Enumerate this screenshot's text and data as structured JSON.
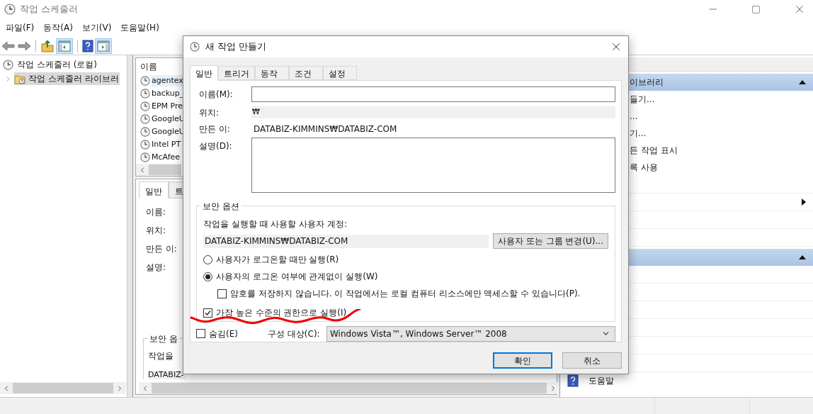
{
  "window": {
    "title": "작업 스케줄러"
  },
  "menu": [
    "파일(F)",
    "동작(A)",
    "보기(V)",
    "도움말(H)"
  ],
  "tree": [
    {
      "label": "작업 스케줄러 (로컬)",
      "selected": false,
      "children": [
        {
          "label": "작업 스케줄러 라이브러",
          "selected": true,
          "expanded": false
        }
      ]
    }
  ],
  "task_list": {
    "column": "이름",
    "rows": [
      {
        "name": "agentex",
        "selected": true
      },
      {
        "name": "backup_",
        "selected": false
      },
      {
        "name": "EPM Pre",
        "selected": false
      },
      {
        "name": "GoogleU",
        "selected": false
      },
      {
        "name": "GoogleU",
        "selected": false
      },
      {
        "name": "Intel PT",
        "selected": false
      },
      {
        "name": "McAfee",
        "selected": false
      }
    ]
  },
  "details": {
    "tabs": [
      {
        "label": "일반",
        "selected": true
      },
      {
        "label": "트",
        "selected": false
      }
    ],
    "fields": [
      "이름:",
      "위치:",
      "만든 이:",
      "설명:"
    ],
    "group": "보안 옵",
    "group_text": "작업을",
    "account": "DATABIZ-"
  },
  "actions": [
    {
      "title": "이브러리",
      "expanded": true,
      "items": [
        {
          "kind": "text",
          "label": "들기..."
        },
        {
          "kind": "text",
          "label": "..."
        },
        {
          "kind": "text",
          "label": "기..."
        },
        {
          "kind": "text",
          "label": "든 작업 표시"
        },
        {
          "kind": "text",
          "label": "록 사용"
        },
        {
          "kind": "blank"
        },
        {
          "kind": "submenu"
        },
        {
          "kind": "blank"
        },
        {
          "kind": "blank"
        }
      ]
    },
    {
      "expanded": true,
      "items": [
        {
          "kind": "blank"
        },
        {
          "kind": "blank"
        },
        {
          "kind": "blank"
        },
        {
          "kind": "blank"
        },
        {
          "kind": "blank"
        },
        {
          "kind": "blank"
        },
        {
          "kind": "help",
          "label": "도움말"
        }
      ]
    }
  ],
  "dialog": {
    "title": "새 작업 만들기",
    "tabs": [
      {
        "label": "일반",
        "selected": true
      },
      {
        "label": "트리거",
        "selected": false
      },
      {
        "label": "동작",
        "selected": false
      },
      {
        "label": "조건",
        "selected": false
      },
      {
        "label": "설정",
        "selected": false
      }
    ],
    "name_label": "이름(M):",
    "location_label": "위치:",
    "location": "₩",
    "author_label": "만든 이:",
    "author": "DATABIZ-KIMMINS₩DATABIZ-COM",
    "description_label": "설명(D):",
    "security": {
      "title": "보안 옵션",
      "account_label": "작업을 실행할 때 사용할 사용자 계정:",
      "account": "DATABIZ-KIMMINS₩DATABIZ-COM",
      "change_button": "사용자 또는 그룹 변경(U)...",
      "options": [
        {
          "kind": "radio",
          "label": "사용자가 로그온할 때만 실행(R)",
          "selected": false
        },
        {
          "kind": "radio",
          "label": "사용자의 로그온 여부에 관계없이 실행(W)",
          "selected": true
        },
        {
          "kind": "checkbox",
          "indent": true,
          "label": "암호를 저장하지 않습니다. 이 작업에서는 로컬 컴퓨터 리소스에만 액세스할 수 있습니다(P).",
          "checked": false
        },
        {
          "kind": "checkbox",
          "indent": false,
          "label": "가장 높은 수준의 권한으로 실행(I)",
          "checked": true
        }
      ]
    },
    "hidden": {
      "label": "숨김(E)",
      "checked": false
    },
    "configure_label": "구성 대상(C):",
    "configure_value": "Windows Vista™, Windows Server™ 2008",
    "buttons": [
      {
        "label": "확인",
        "default": true
      },
      {
        "label": "취소",
        "default": false
      }
    ]
  }
}
